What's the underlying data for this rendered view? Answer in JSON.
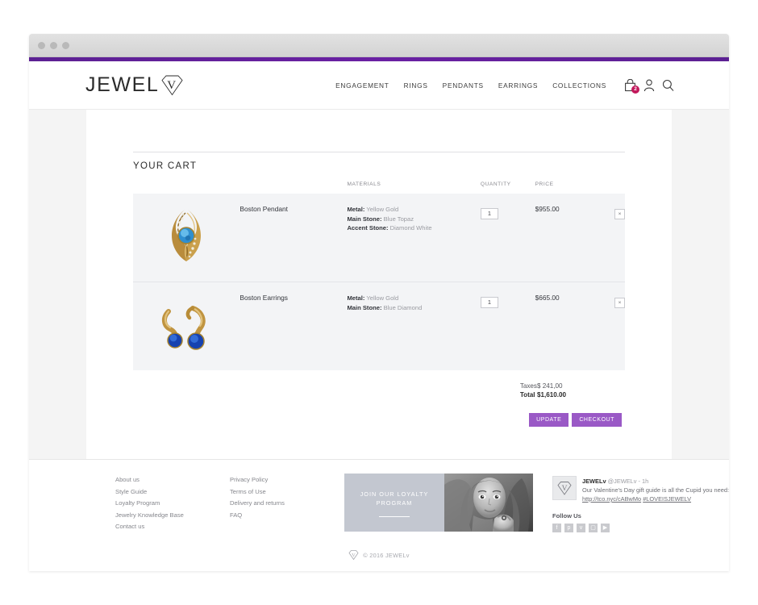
{
  "browser": {
    "dots": [
      "dot-1",
      "dot-2",
      "dot-3"
    ]
  },
  "header": {
    "logo_text": "JEWEL",
    "logo_icon": "diamond-v-logo",
    "nav": [
      {
        "label": "ENGAGEMENT"
      },
      {
        "label": "RINGS"
      },
      {
        "label": "PENDANTS"
      },
      {
        "label": "EARRINGS"
      },
      {
        "label": "COLLECTIONS"
      }
    ],
    "icons": {
      "cart": "shopping-bag-icon",
      "cart_count": "2",
      "account": "user-icon",
      "search": "search-icon"
    }
  },
  "cart": {
    "title": "YOUR CART",
    "columns": {
      "image": "",
      "name": "",
      "materials": "MATERIALS",
      "quantity": "QUANTITY",
      "price": "PRICE",
      "remove": ""
    },
    "items": [
      {
        "name": "Boston Pendant",
        "image": "boston-pendant-photo",
        "materials": [
          {
            "key": "Metal:",
            "value": "Yellow Gold"
          },
          {
            "key": "Main Stone:",
            "value": "Blue Topaz"
          },
          {
            "key": "Accent Stone:",
            "value": "Diamond White"
          }
        ],
        "quantity": "1",
        "price": "$955.00",
        "remove_label": "×"
      },
      {
        "name": "Boston Earrings",
        "image": "boston-earrings-photo",
        "materials": [
          {
            "key": "Metal:",
            "value": "Yellow Gold"
          },
          {
            "key": "Main Stone:",
            "value": "Blue Diamond"
          }
        ],
        "quantity": "1",
        "price": "$665.00",
        "remove_label": "×"
      }
    ],
    "totals": {
      "taxes_label": "Taxes",
      "taxes_value": "$ 241,00",
      "total_label": "Total",
      "total_value": "$1,610.00"
    },
    "actions": {
      "update_label": "UPDATE",
      "checkout_label": "CHECKOUT"
    }
  },
  "footer": {
    "links_col1": [
      {
        "label": "About us"
      },
      {
        "label": "Style Guide"
      },
      {
        "label": "Loyalty Program"
      },
      {
        "label": "Jewelry Knowledge Base"
      },
      {
        "label": "Contact us"
      }
    ],
    "links_col2": [
      {
        "label": "Privacy Policy"
      },
      {
        "label": "Terms of Use"
      },
      {
        "label": "Delivery and returns"
      },
      {
        "label": "FAQ"
      }
    ],
    "promo": {
      "line1": "JOIN OUR LOYALTY",
      "line2": "PROGRAM",
      "image": "model-portrait-photo"
    },
    "tweet": {
      "avatar": "diamond-v-avatar",
      "author": "JEWELv",
      "handle": "@JEWELv - 1h",
      "text": "Our Valentine's Day gift guide is all the Cupid you need: ",
      "link": "http://tco.nyc/cABwMo",
      "hashtag": "#LOVEISJEWELV"
    },
    "follow_label": "Follow Us",
    "social": [
      {
        "name": "facebook-icon",
        "glyph": "f"
      },
      {
        "name": "pinterest-icon",
        "glyph": "р"
      },
      {
        "name": "twitter-icon",
        "glyph": "ᴠ"
      },
      {
        "name": "instagram-icon",
        "glyph": "▢"
      },
      {
        "name": "youtube-icon",
        "glyph": "▶"
      }
    ],
    "copyright": "© 2016 JEWELv",
    "copyright_logo": "diamond-v-logo-small"
  },
  "theme": {
    "accent_purple": "#5c2193",
    "button_purple": "#9a59c6",
    "badge_pink": "#c2185b",
    "row_bg": "#f3f4f6"
  }
}
